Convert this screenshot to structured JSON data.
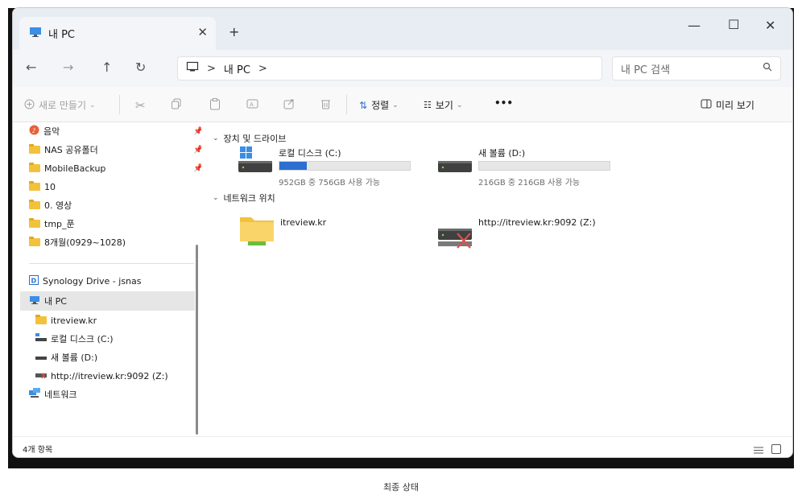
{
  "window": {
    "tab_title": "내 PC",
    "tab_close": "✕",
    "new_tab": "+",
    "minimize": "—",
    "maximize": "☐",
    "close": "✕"
  },
  "nav": {
    "back": "←",
    "forward": "→",
    "up": "↑",
    "refresh": "↻"
  },
  "address": {
    "sep1": ">",
    "current": "내 PC",
    "sep2": ">"
  },
  "search": {
    "placeholder": "내 PC 검색",
    "icon": "search-icon"
  },
  "toolbar": {
    "new_label": "새로 만들기",
    "sort_label": "정렬",
    "view_label": "보기",
    "more_label": "•••",
    "preview_label": "미리 보기"
  },
  "sidebar": {
    "items": [
      {
        "label": "음악",
        "icon": "music-icon",
        "pinned": true
      },
      {
        "label": "NAS 공유폴더",
        "icon": "folder-icon",
        "pinned": true
      },
      {
        "label": "MobileBackup",
        "icon": "folder-icon",
        "pinned": true
      },
      {
        "label": "10",
        "icon": "folder-icon",
        "pinned": false
      },
      {
        "label": "0. 영상",
        "icon": "folder-icon",
        "pinned": false
      },
      {
        "label": "tmp_푼",
        "icon": "folder-icon",
        "pinned": false
      },
      {
        "label": "8개월(0929~1028)",
        "icon": "folder-icon",
        "pinned": false
      },
      {
        "label": "Synology Drive - jsnas",
        "icon": "synology-icon",
        "pinned": false
      },
      {
        "label": "내 PC",
        "icon": "pc-icon",
        "pinned": false,
        "selected": true
      },
      {
        "label": "itreview.kr",
        "icon": "folder-icon",
        "pinned": false
      },
      {
        "label": "로컬 디스크 (C:)",
        "icon": "drive-icon",
        "pinned": false
      },
      {
        "label": "새 볼륨 (D:)",
        "icon": "drive-icon",
        "pinned": false
      },
      {
        "label": "http://itreview.kr:9092 (Z:)",
        "icon": "network-drive-icon",
        "pinned": false
      },
      {
        "label": "네트워크",
        "icon": "network-icon",
        "pinned": false
      }
    ]
  },
  "content": {
    "group1": "장치 및 드라이브",
    "group2": "네트워크 위치",
    "drives": [
      {
        "name": "로컬 디스크 (C:)",
        "free_text": "952GB 중 756GB 사용 가능",
        "used_fraction": 0.21
      },
      {
        "name": "새 볼륨 (D:)",
        "free_text": "216GB 중 216GB 사용 가능",
        "used_fraction": 0.0
      }
    ],
    "network": [
      {
        "name": "itreview.kr"
      },
      {
        "name": "http://itreview.kr:9092 (Z:)"
      }
    ]
  },
  "status": {
    "count": "4개 항목"
  },
  "caption": "최종 상태",
  "colors": {
    "accent": "#2b6fcf",
    "folder": "#f3c23c",
    "selected_row": "#e6e6e6"
  }
}
